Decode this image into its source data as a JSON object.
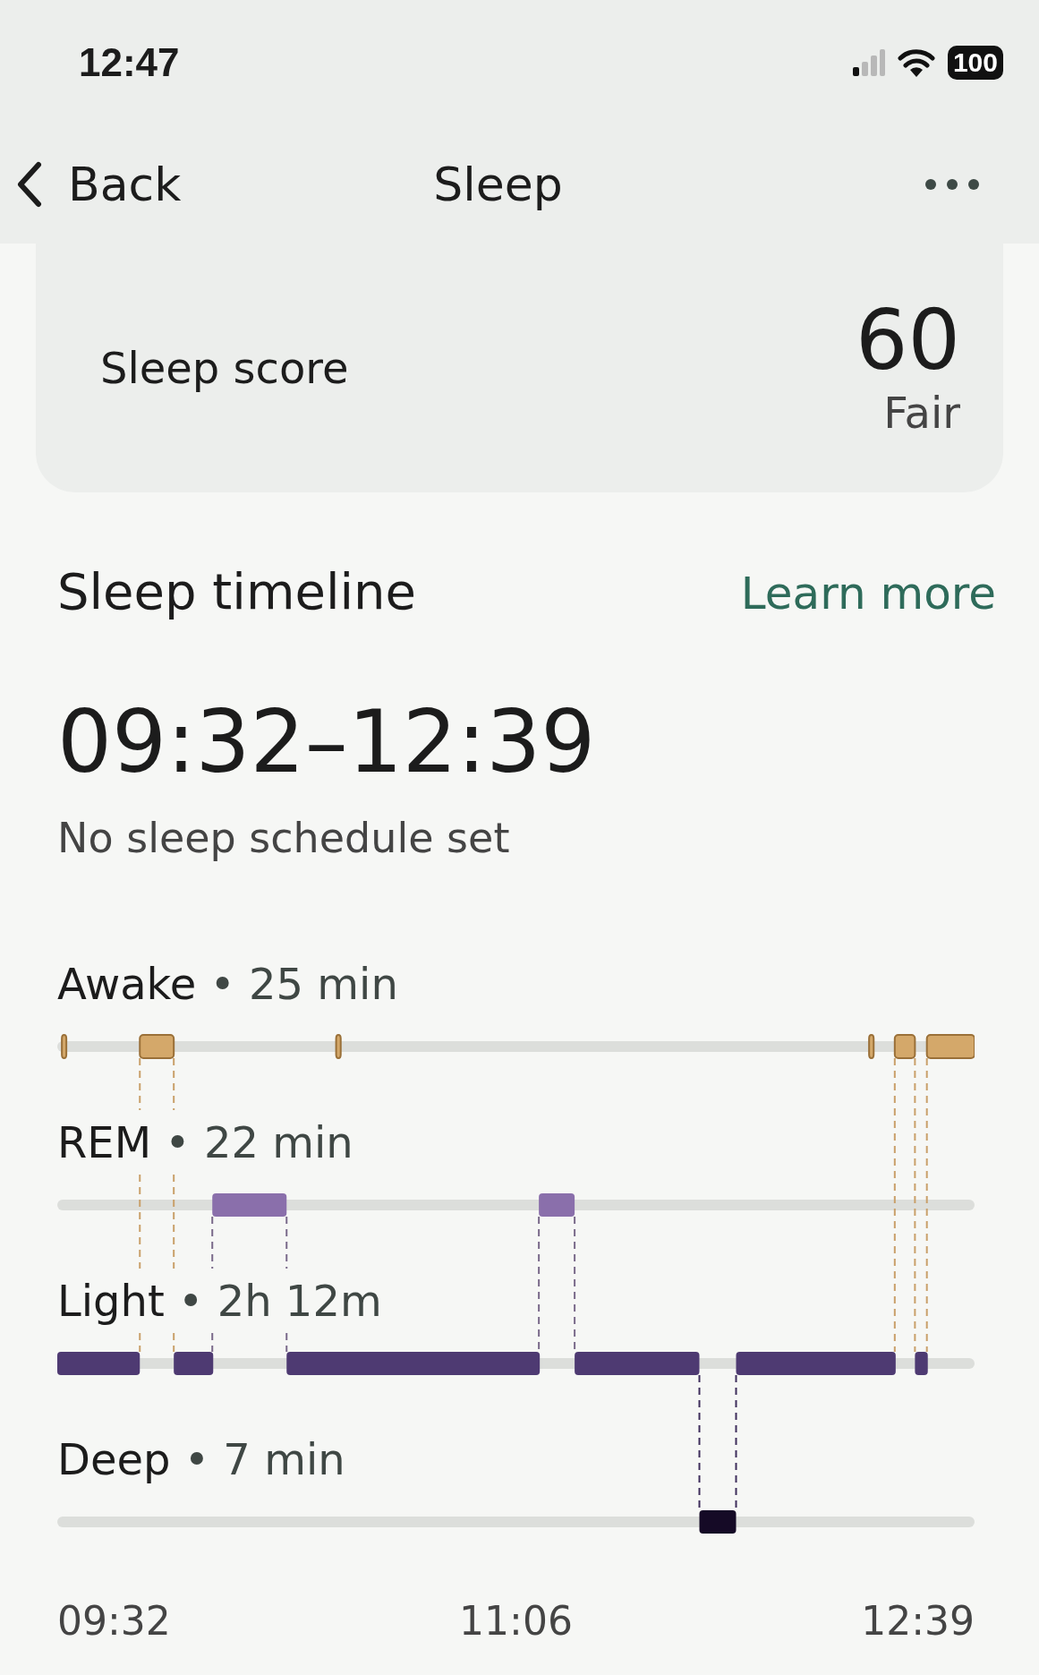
{
  "status_bar": {
    "time": "12:47",
    "battery": "100"
  },
  "nav": {
    "back": "Back",
    "title": "Sleep"
  },
  "score_card": {
    "label": "Sleep score",
    "score": "60",
    "rating": "Fair"
  },
  "timeline": {
    "title": "Sleep timeline",
    "link": "Learn more",
    "range": "09:32–12:39",
    "note": "No sleep schedule set",
    "stages": [
      {
        "kind": "awake",
        "name": "Awake",
        "duration": "• 25 min"
      },
      {
        "kind": "rem",
        "name": "REM",
        "duration": "• 22 min"
      },
      {
        "kind": "light",
        "name": "Light",
        "duration": "• 2h 12m"
      },
      {
        "kind": "deep",
        "name": "Deep",
        "duration": "• 7 min"
      }
    ],
    "axis_labels": [
      "09:32",
      "11:06",
      "12:39"
    ]
  }
}
